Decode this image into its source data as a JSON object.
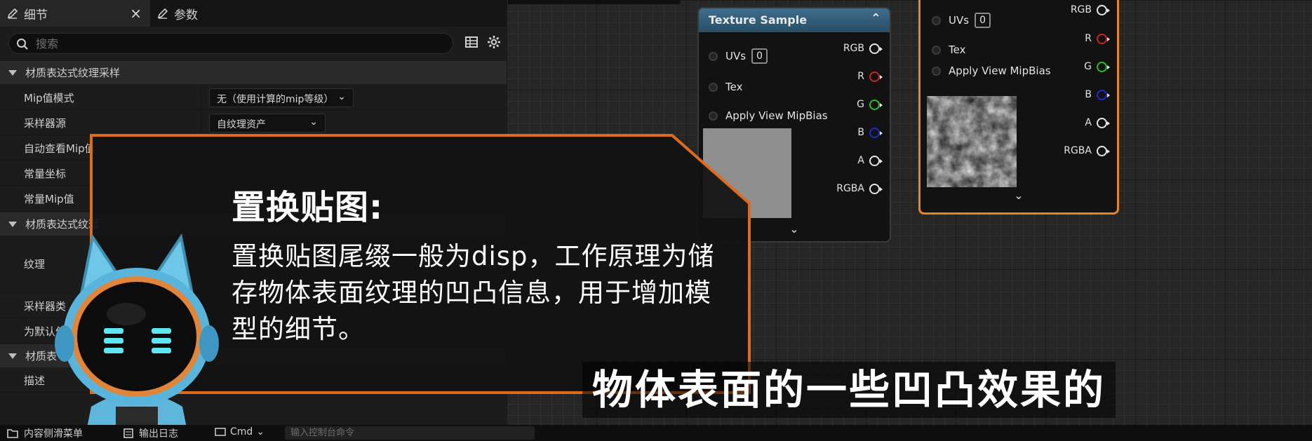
{
  "tabs": [
    {
      "label": "细节",
      "icon": "pencil-icon",
      "active": true,
      "close": "×"
    },
    {
      "label": "参数",
      "icon": "pencil-icon",
      "active": false
    }
  ],
  "search": {
    "placeholder": "搜索"
  },
  "categories": [
    {
      "label": "材质表达式纹理采样"
    },
    {
      "label": "材质表达式纹理"
    },
    {
      "label": "材质表"
    }
  ],
  "properties": [
    {
      "label": "Mip值模式",
      "value": "无（使用计算的mip等级）"
    },
    {
      "label": "采样器源",
      "value": "自纹理资产"
    },
    {
      "label": "自动查看Mip值"
    },
    {
      "label": "常量坐标"
    },
    {
      "label": "常量Mip值"
    },
    {
      "label": "纹理"
    },
    {
      "label": "采样器类"
    },
    {
      "label": "为默认值"
    },
    {
      "label": "描述"
    }
  ],
  "node_main": {
    "title": "Texture Sample",
    "inputs": [
      "UVs",
      "Tex",
      "Apply View MipBias"
    ],
    "uv_index": "0",
    "outputs": [
      {
        "label": "RGB",
        "color": "#e8e8e8"
      },
      {
        "label": "R",
        "color": "#d42020"
      },
      {
        "label": "G",
        "color": "#22c422"
      },
      {
        "label": "B",
        "color": "#1c2ad8"
      },
      {
        "label": "A",
        "color": "#e8e8e8"
      },
      {
        "label": "RGBA",
        "color": "#e8e8e8"
      }
    ],
    "expand": "⌄"
  },
  "node_selected": {
    "inputs": [
      "UVs",
      "Tex",
      "Apply View MipBias"
    ],
    "uv_index": "0",
    "outputs": [
      {
        "label": "RGB",
        "color": "#e8e8e8"
      },
      {
        "label": "R",
        "color": "#d42020"
      },
      {
        "label": "G",
        "color": "#22c422"
      },
      {
        "label": "B",
        "color": "#1c2ad8"
      },
      {
        "label": "A",
        "color": "#e8e8e8"
      },
      {
        "label": "RGBA",
        "color": "#e8e8e8"
      }
    ],
    "expand": "⌄",
    "border_color": "#e4871d"
  },
  "callout": {
    "title": "置换贴图:",
    "body": "置换贴图尾缀一般为disp，工作原理为储存物体表面纹理的凹凸信息，用于增加模型的细节。",
    "border_color": "#e06a1c"
  },
  "subtitle": "物体表面的一些凹凸效果的",
  "statusbar": {
    "content_drawer": "内容侧滑菜单",
    "output_log": "输出日志",
    "cmd": "Cmd",
    "cmd_placeholder": "输入控制台命令"
  }
}
